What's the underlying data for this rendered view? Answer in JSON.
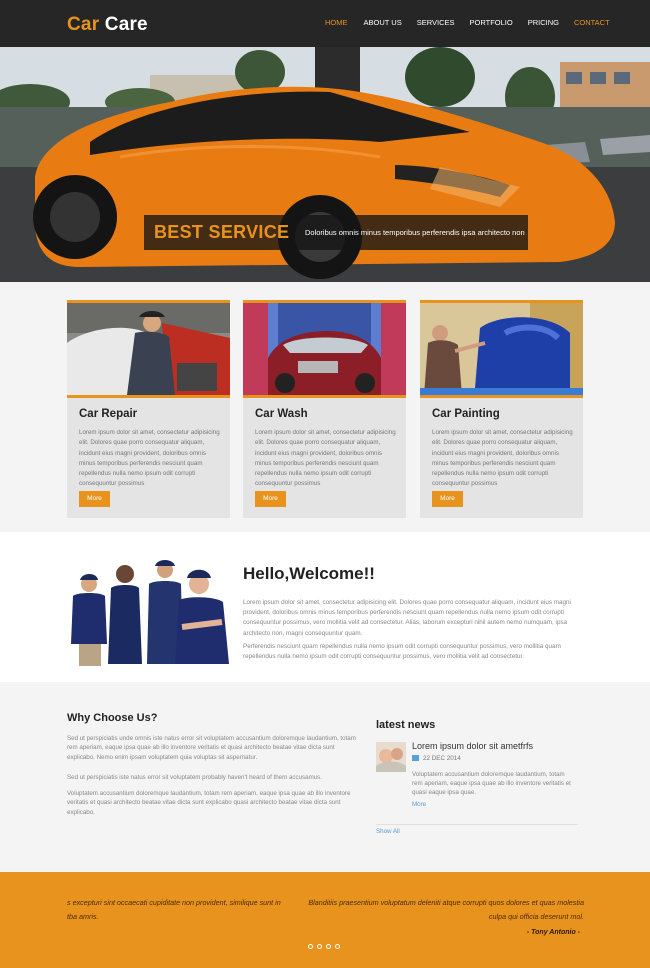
{
  "brand": {
    "part1": "Car",
    "part2": " Care"
  },
  "nav": {
    "items": [
      "HOME",
      "ABOUT US",
      "SERVICES",
      "PORTFOLIO",
      "PRICING",
      "CONTACT"
    ],
    "active_color": "#e9931f"
  },
  "hero": {
    "title": "BEST SERVICE",
    "text": "Doloribus omnis minus temporibus perferendis ipsa architecto non"
  },
  "services": [
    {
      "title": "Car Repair",
      "body": "Lorem ipsum dolor sit amet, consectetur adipisicing elit. Dolores quae porro consequatur aliquam, incidunt eius magni provident, doloribus omnis minus temporibus perferendis nesciunt quam repellendus nulla nemo ipsum odit corrupti consequuntur possimus",
      "button": "More"
    },
    {
      "title": "Car Wash",
      "body": "Lorem ipsum dolor sit amet, consectetur adipisicing elit. Dolores quae porro consequatur aliquam, incidunt eius magni provident, doloribus omnis minus temporibus perferendis nesciunt quam repellendus nulla nemo ipsum odit corrupti consequuntur possimus",
      "button": "More"
    },
    {
      "title": "Car Painting",
      "body": "Lorem ipsum dolor sit amet, consectetur adipisicing elit. Dolores quae porro consequatur aliquam, incidunt eius magni provident, doloribus omnis minus temporibus perferendis nesciunt quam repellendus nulla nemo ipsum odit corrupti consequuntur possimus",
      "button": "More"
    }
  ],
  "welcome": {
    "title": "Hello,Welcome!!",
    "p1": "Lorem ipsum dolor sit amet, consectetur adipisicing elit. Dolores quae porro consequatur aliquam, incidunt eius magni provident, doloribus omnis minus temporibus perferendis nesciunt quam repellendus nulla nemo ipsum odit corrupti consequuntur possimus, vero mollitia velit ad consectetur. Alias, laborum excepturi nihil autem nemo numquam, ipsa architecto non, magni consequuntur quam.",
    "p2": "Perferendis nesciunt quam repellendus nulla nemo ipsum odit corrupti consequuntur possimus, vero mollitia quam repellendus nulla nemo ipsum odit corrupti consequuntur possimus, vero mollitia velit ad consectetur."
  },
  "why": {
    "title": "Why Choose Us?",
    "p1": "Sed ut perspiciatis unde omnis iste natus error sit voluptatem accusantium doloremque laudantium, totam rem aperiam, eaque ipsa quae ab illo inventore veritatis et quasi architecto beatae vitae dicta sunt explicabo. Nemo enim ipsam voluptatem quia voluptas sit aspernatur.",
    "p2": "Sed ut perspiciatis iste natus error sit voluptatem probably haven't heard of them accusamus.",
    "p3": "Voluptatem accusantium doloremque laudantium, totam rem aperiam, eaque ipsa quae ab illo inventore veritatis et quasi architecto beatae vitae dicta sunt explicabo quasi architecto beatae vitae dicta sunt explicabo."
  },
  "news": {
    "title": "latest news",
    "headline": "Lorem ipsum dolor sit ametfrfs",
    "date": "22 DEC 2014",
    "body": "Voluptatem accusantium doloremque laudantium, totam rem aperiam, eaque ipsa quae ab illo inventore veritatis et quasi eaque ipsa quae.",
    "more": "More",
    "show_all": "Show All"
  },
  "testimonial": {
    "left": "s excepturi sint occaecati cupiditate non provident, similique sunt in tba amris.",
    "right": "Blanditiis praesentium voluptatum deleniti atque corrupti quos dolores et quas molestia culpa qui officia deserunt mol.",
    "author": "- Tony Antonio -"
  },
  "colors": {
    "accent": "#e9931f",
    "nav_bg": "#262626",
    "card_bg": "#e4e4e4"
  }
}
